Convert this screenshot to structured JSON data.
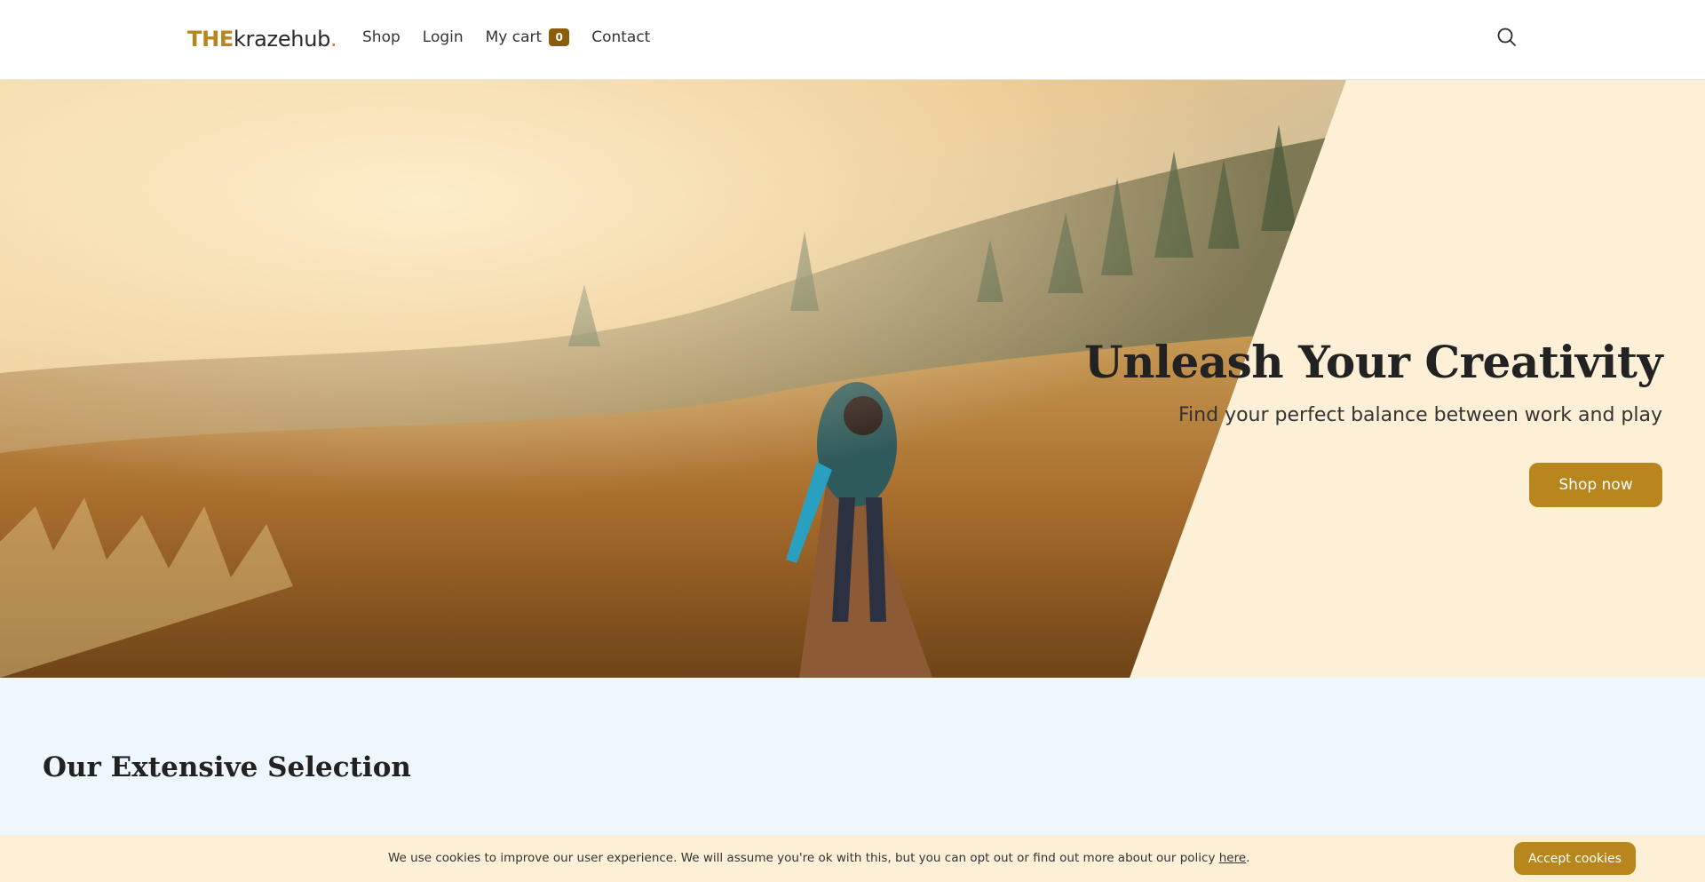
{
  "header": {
    "logo": {
      "prefix": "THE",
      "name": "krazehub",
      "suffix": "."
    },
    "nav": {
      "shop": "Shop",
      "login": "Login",
      "cart": "My cart",
      "cart_count": "0",
      "contact": "Contact"
    },
    "search_icon": "search-icon"
  },
  "hero": {
    "image": "hiker-on-boardwalk-photo",
    "title": "Unleash Your Creativity",
    "subtitle": "Find your perfect balance between work and play",
    "cta": "Shop now"
  },
  "selection": {
    "title": "Our Extensive Selection"
  },
  "cookie": {
    "text": "We use cookies to improve our user experience. We will assume you're ok with this, but you can opt out or find out more about our policy ",
    "link": "here",
    "end": ".",
    "button": "Accept cookies"
  },
  "colors": {
    "accent": "#b8861c",
    "badge": "#8a5d0c",
    "hero_bg": "#fdf0d6",
    "section_bg": "#eef6fe"
  }
}
